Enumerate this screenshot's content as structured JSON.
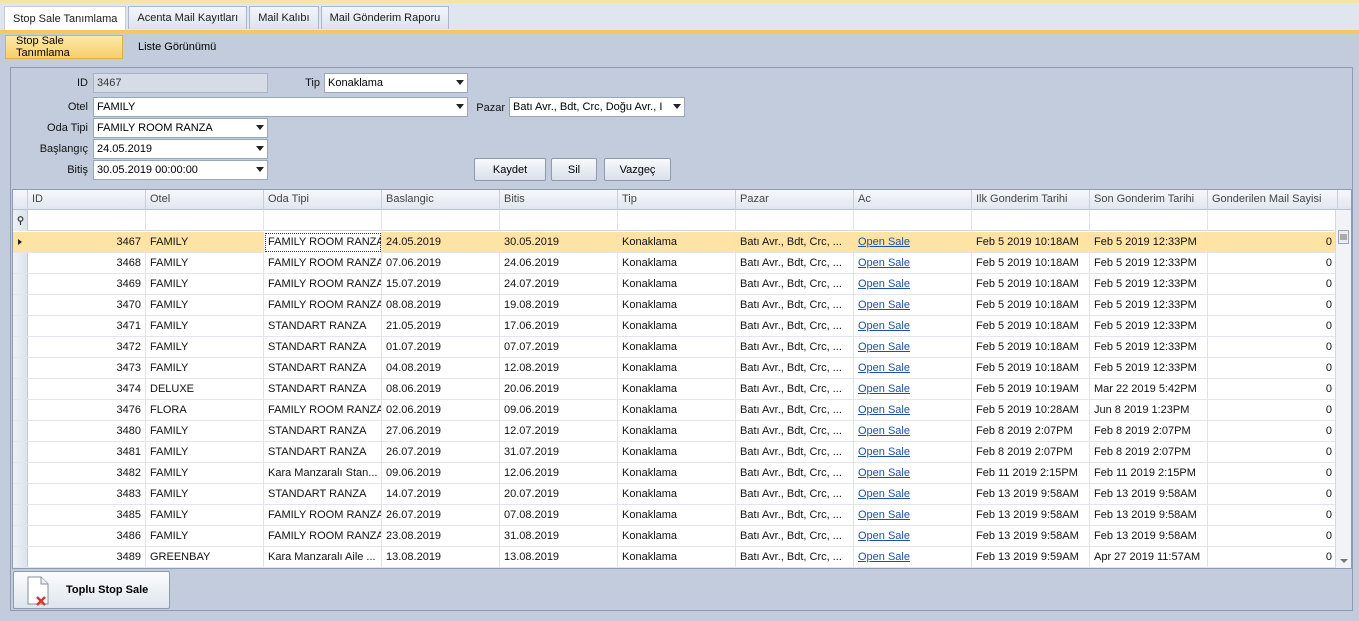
{
  "top_tabs": [
    "Stop Sale Tanımlama",
    "Acenta Mail Kayıtları",
    "Mail Kalıbı",
    "Mail Gönderim Raporu"
  ],
  "inner_tabs": [
    "Stop Sale Tanımlama",
    "Liste Görünümü"
  ],
  "form": {
    "id_label": "ID",
    "id_value": "3467",
    "tip_label": "Tip",
    "tip_value": "Konaklama",
    "otel_label": "Otel",
    "otel_value": "FAMILY",
    "pazar_label": "Pazar",
    "pazar_value": "Batı Avr., Bdt, Crc, Doğu Avr., I",
    "oda_label": "Oda Tipi",
    "oda_value": "FAMILY ROOM RANZA",
    "baslangic_label": "Başlangıç",
    "baslangic_value": "24.05.2019",
    "bitis_label": "Bitiş",
    "bitis_value": "30.05.2019 00:00:00",
    "kaydet": "Kaydet",
    "sil": "Sil",
    "vazgec": "Vazgeç"
  },
  "grid": {
    "columns": [
      "ID",
      "Otel",
      "Oda Tipi",
      "Baslangic",
      "Bitis",
      "Tip",
      "Pazar",
      "Ac",
      "Ilk Gonderim Tarihi",
      "Son Gonderim Tarihi",
      "Gonderilen Mail Sayisi"
    ],
    "rows": [
      [
        "3467",
        "FAMILY",
        "FAMILY ROOM RANZA",
        "24.05.2019",
        "30.05.2019",
        "Konaklama",
        "Batı Avr., Bdt, Crc, ...",
        "Open Sale",
        "Feb  5 2019 10:18AM",
        "Feb  5 2019 12:33PM",
        "0"
      ],
      [
        "3468",
        "FAMILY",
        "FAMILY ROOM RANZA",
        "07.06.2019",
        "24.06.2019",
        "Konaklama",
        "Batı Avr., Bdt, Crc, ...",
        "Open Sale",
        "Feb  5 2019 10:18AM",
        "Feb  5 2019 12:33PM",
        "0"
      ],
      [
        "3469",
        "FAMILY",
        "FAMILY ROOM RANZA",
        "15.07.2019",
        "24.07.2019",
        "Konaklama",
        "Batı Avr., Bdt, Crc, ...",
        "Open Sale",
        "Feb  5 2019 10:18AM",
        "Feb  5 2019 12:33PM",
        "0"
      ],
      [
        "3470",
        "FAMILY",
        "FAMILY ROOM RANZA",
        "08.08.2019",
        "19.08.2019",
        "Konaklama",
        "Batı Avr., Bdt, Crc, ...",
        "Open Sale",
        "Feb  5 2019 10:18AM",
        "Feb  5 2019 12:33PM",
        "0"
      ],
      [
        "3471",
        "FAMILY",
        "STANDART RANZA",
        "21.05.2019",
        "17.06.2019",
        "Konaklama",
        "Batı Avr., Bdt, Crc, ...",
        "Open Sale",
        "Feb  5 2019 10:18AM",
        "Feb  5 2019 12:33PM",
        "0"
      ],
      [
        "3472",
        "FAMILY",
        "STANDART RANZA",
        "01.07.2019",
        "07.07.2019",
        "Konaklama",
        "Batı Avr., Bdt, Crc, ...",
        "Open Sale",
        "Feb  5 2019 10:18AM",
        "Feb  5 2019 12:33PM",
        "0"
      ],
      [
        "3473",
        "FAMILY",
        "STANDART RANZA",
        "04.08.2019",
        "12.08.2019",
        "Konaklama",
        "Batı Avr., Bdt, Crc, ...",
        "Open Sale",
        "Feb  5 2019 10:18AM",
        "Feb  5 2019 12:33PM",
        "0"
      ],
      [
        "3474",
        "DELUXE",
        "STANDART RANZA",
        "08.06.2019",
        "20.06.2019",
        "Konaklama",
        "Batı Avr., Bdt, Crc, ...",
        "Open Sale",
        "Feb  5 2019 10:19AM",
        "Mar 22 2019  5:42PM",
        "0"
      ],
      [
        "3476",
        "FLORA",
        "FAMILY ROOM RANZA",
        "02.06.2019",
        "09.06.2019",
        "Konaklama",
        "Batı Avr., Bdt, Crc, ...",
        "Open Sale",
        "Feb  5 2019 10:28AM",
        "Jun  8 2019  1:23PM",
        "0"
      ],
      [
        "3480",
        "FAMILY",
        "STANDART RANZA",
        "27.06.2019",
        "12.07.2019",
        "Konaklama",
        "Batı Avr., Bdt, Crc, ...",
        "Open Sale",
        "Feb  8 2019  2:07PM",
        "Feb  8 2019  2:07PM",
        "0"
      ],
      [
        "3481",
        "FAMILY",
        "STANDART RANZA",
        "26.07.2019",
        "31.07.2019",
        "Konaklama",
        "Batı Avr., Bdt, Crc, ...",
        "Open Sale",
        "Feb  8 2019  2:07PM",
        "Feb  8 2019  2:07PM",
        "0"
      ],
      [
        "3482",
        "FAMILY",
        "Kara Manzaralı Stan...",
        "09.06.2019",
        "12.06.2019",
        "Konaklama",
        "Batı Avr., Bdt, Crc, ...",
        "Open Sale",
        "Feb 11 2019  2:15PM",
        "Feb 11 2019  2:15PM",
        "0"
      ],
      [
        "3483",
        "FAMILY",
        "STANDART RANZA",
        "14.07.2019",
        "20.07.2019",
        "Konaklama",
        "Batı Avr., Bdt, Crc, ...",
        "Open Sale",
        "Feb 13 2019  9:58AM",
        "Feb 13 2019  9:58AM",
        "0"
      ],
      [
        "3485",
        "FAMILY",
        "FAMILY ROOM RANZA",
        "26.07.2019",
        "07.08.2019",
        "Konaklama",
        "Batı Avr., Bdt, Crc, ...",
        "Open Sale",
        "Feb 13 2019  9:58AM",
        "Feb 13 2019  9:58AM",
        "0"
      ],
      [
        "3486",
        "FAMILY",
        "FAMILY ROOM RANZA",
        "23.08.2019",
        "31.08.2019",
        "Konaklama",
        "Batı Avr., Bdt, Crc, ...",
        "Open Sale",
        "Feb 13 2019  9:58AM",
        "Feb 13 2019  9:58AM",
        "0"
      ],
      [
        "3489",
        "GREENBAY",
        "Kara Manzaralı Aile ...",
        "13.08.2019",
        "13.08.2019",
        "Konaklama",
        "Batı Avr., Bdt, Crc, ...",
        "Open Sale",
        "Feb 13 2019  9:59AM",
        "Apr 27 2019 11:57AM",
        "0"
      ]
    ]
  },
  "footer": {
    "toplu_label": "Toplu Stop Sale"
  },
  "colors": {
    "selected_row": "#fde3a4",
    "active_tab": "#f7cf6b",
    "link": "#1f4fa8"
  }
}
